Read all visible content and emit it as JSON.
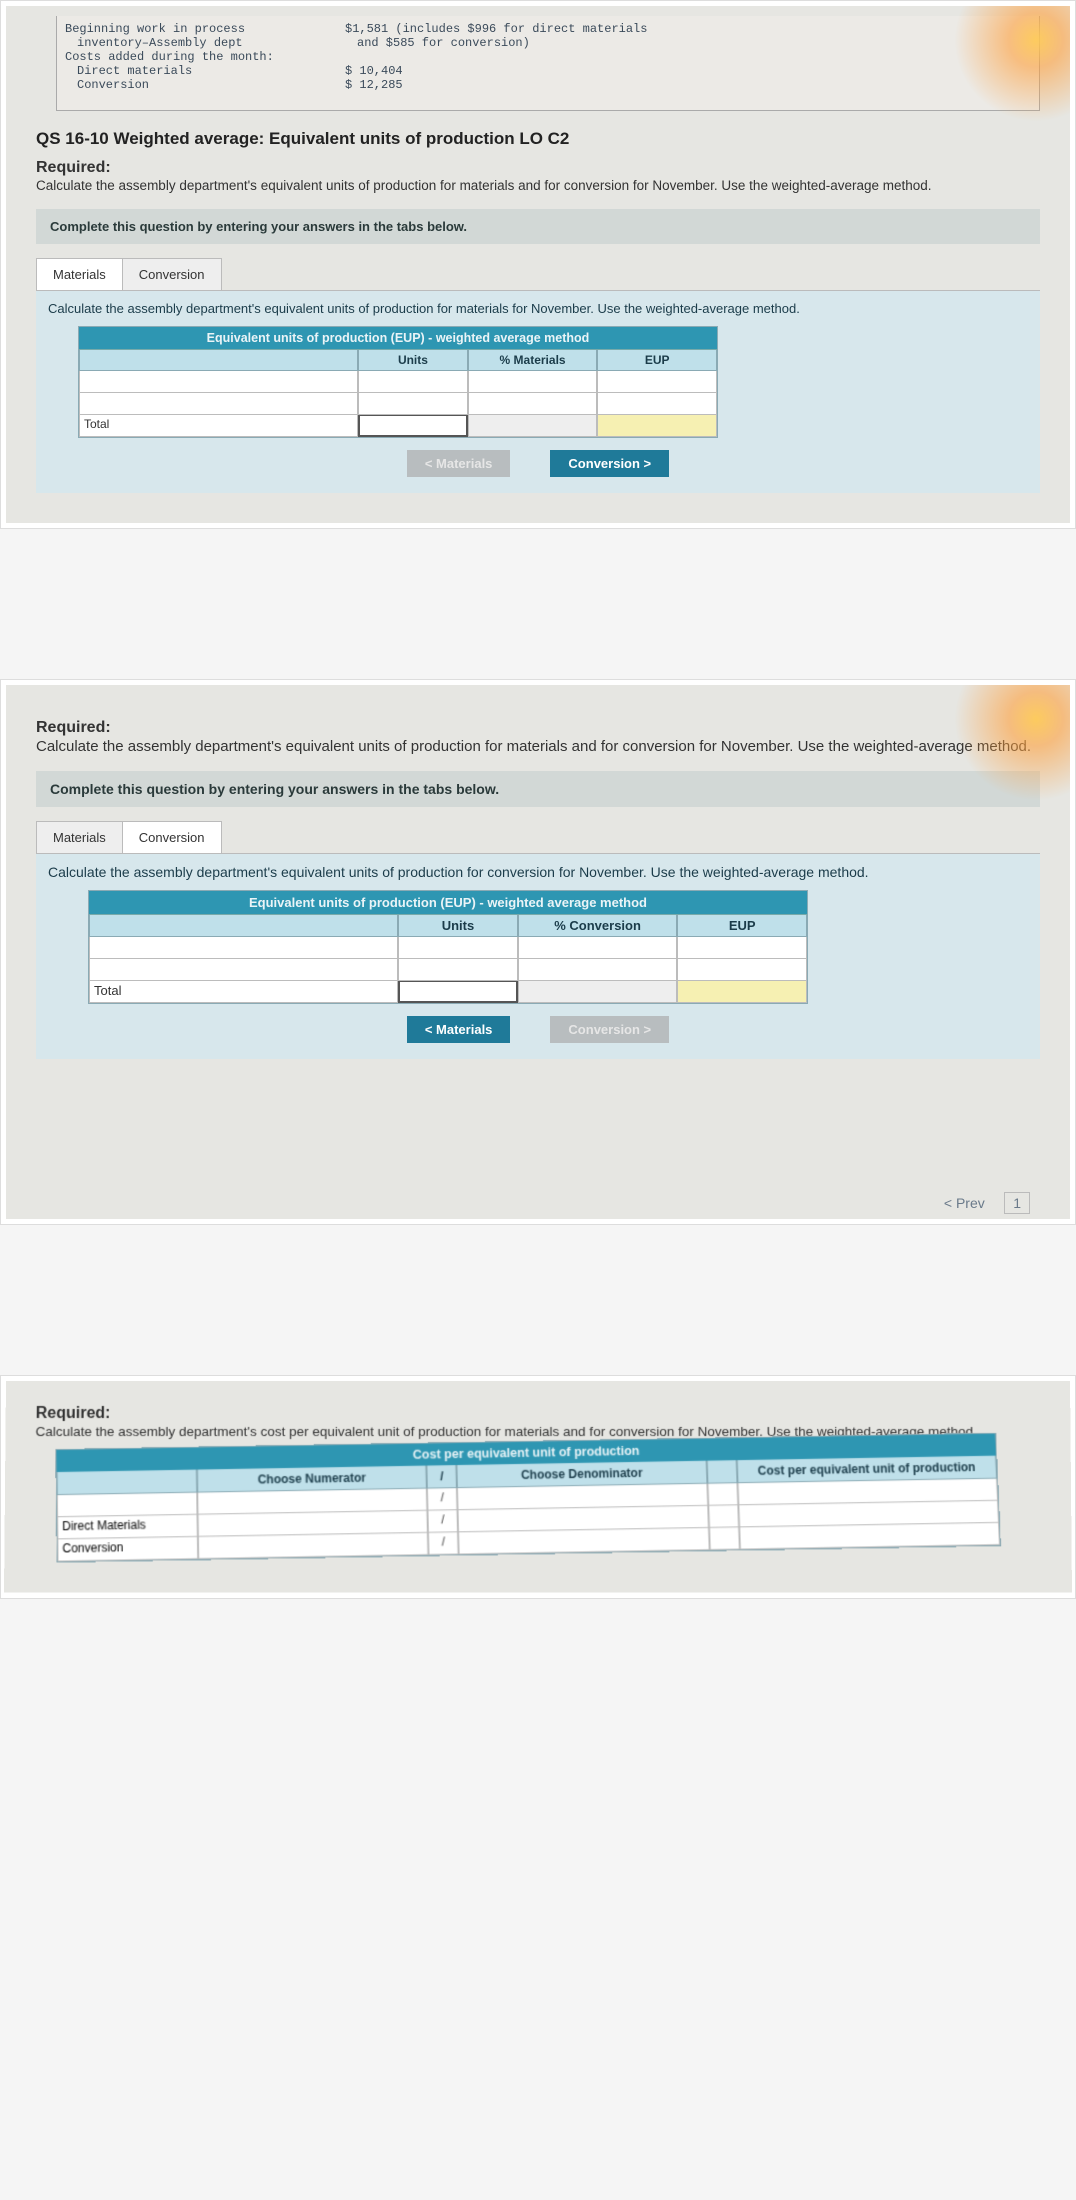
{
  "photo1": {
    "data_rows": [
      {
        "label": "Beginning work in process",
        "value": "$1,581 (includes $996 for direct materials"
      },
      {
        "label": "inventory–Assembly dept",
        "value": "and $585 for conversion)"
      },
      {
        "label": "Costs added during the month:",
        "value": ""
      },
      {
        "label": "Direct materials",
        "value": "$ 10,404"
      },
      {
        "label": "Conversion",
        "value": "$ 12,285"
      }
    ],
    "title": "QS 16-10 Weighted average: Equivalent units of production LO C2",
    "required_label": "Required:",
    "required_text": "Calculate the assembly department's equivalent units of production for materials and for conversion for November. Use the weighted-average method.",
    "hint": "Complete this question by entering your answers in the tabs below.",
    "tabs": {
      "materials": "Materials",
      "conversion": "Conversion"
    },
    "tab_body": "Calculate the assembly department's equivalent units of production for materials for November. Use the weighted-average method.",
    "eup_title": "Equivalent units of production (EUP) - weighted average method",
    "cols": {
      "units": "Units",
      "pct": "% Materials",
      "eup": "EUP"
    },
    "total": "Total",
    "btn_prev": "< Materials",
    "btn_next": "Conversion  >"
  },
  "photo2": {
    "required_label": "Required:",
    "required_text": "Calculate the assembly department's equivalent units of production for materials and for conversion for November. Use the weighted-average method.",
    "hint": "Complete this question by entering your answers in the tabs below.",
    "tabs": {
      "materials": "Materials",
      "conversion": "Conversion"
    },
    "tab_body": "Calculate the assembly department's equivalent units of production for conversion for November. Use the weighted-average method.",
    "eup_title": "Equivalent units of production (EUP) - weighted average method",
    "cols": {
      "units": "Units",
      "pct": "% Conversion",
      "eup": "EUP"
    },
    "total": "Total",
    "btn_prev": "<  Materials",
    "btn_next": "Conversion  >",
    "prev": "<  Prev",
    "page": "1"
  },
  "photo3": {
    "required_label": "Required:",
    "required_text": "Calculate the assembly department's cost per equivalent unit of production for materials and for conversion for November. Use the weighted-average method.",
    "title": "Cost per equivalent unit of production",
    "hdrs": {
      "blank": "",
      "num": "Choose Numerator",
      "slash": "/",
      "den": "Choose Denominator",
      "eq": "",
      "cpe": "Cost per equivalent unit of production"
    },
    "rows": {
      "dm": "Direct Materials",
      "conv": "Conversion"
    },
    "slash": "/"
  }
}
